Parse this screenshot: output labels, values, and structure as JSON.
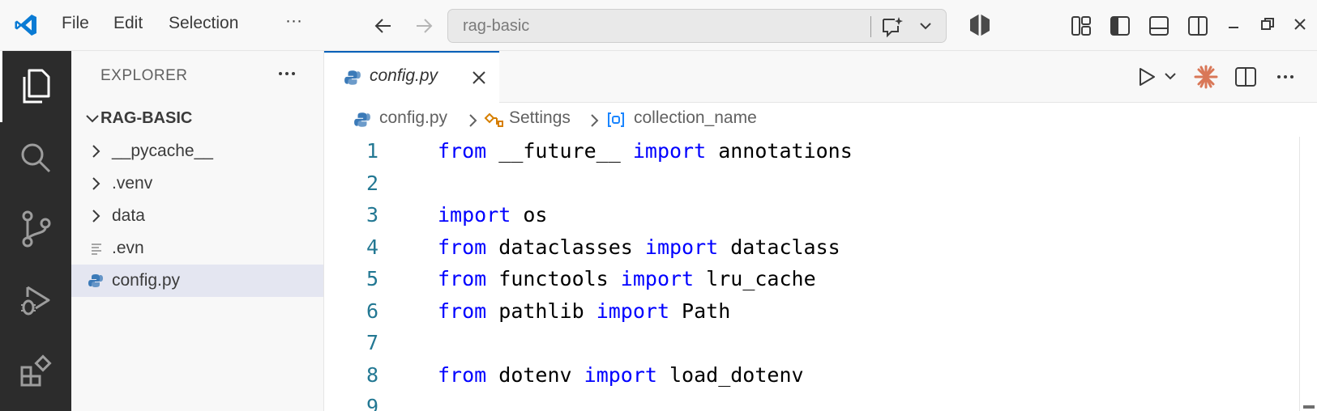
{
  "titlebar": {
    "menu": [
      "File",
      "Edit",
      "Selection"
    ],
    "more_label": "···",
    "search_text": "rag-basic"
  },
  "explorer": {
    "title": "EXPLORER",
    "project": "RAG-BASIC",
    "items": [
      {
        "label": "__pycache__",
        "type": "folder"
      },
      {
        "label": ".venv",
        "type": "folder"
      },
      {
        "label": "data",
        "type": "folder"
      },
      {
        "label": ".evn",
        "type": "file"
      },
      {
        "label": "config.py",
        "type": "python",
        "selected": true
      }
    ]
  },
  "tab": {
    "label": "config.py"
  },
  "breadcrumb": {
    "file": "config.py",
    "class": "Settings",
    "field": "collection_name"
  },
  "editor": {
    "lines": [
      {
        "n": "1",
        "tokens": [
          [
            "kw",
            "from"
          ],
          [
            "t",
            " __future__ "
          ],
          [
            "kw",
            "import"
          ],
          [
            "t",
            " annotations"
          ]
        ]
      },
      {
        "n": "2",
        "tokens": []
      },
      {
        "n": "3",
        "tokens": [
          [
            "kw",
            "import"
          ],
          [
            "t",
            " os"
          ]
        ]
      },
      {
        "n": "4",
        "tokens": [
          [
            "kw",
            "from"
          ],
          [
            "t",
            " dataclasses "
          ],
          [
            "kw",
            "import"
          ],
          [
            "t",
            " dataclass"
          ]
        ]
      },
      {
        "n": "5",
        "tokens": [
          [
            "kw",
            "from"
          ],
          [
            "t",
            " functools "
          ],
          [
            "kw",
            "import"
          ],
          [
            "t",
            " lru_cache"
          ]
        ]
      },
      {
        "n": "6",
        "tokens": [
          [
            "kw",
            "from"
          ],
          [
            "t",
            " pathlib "
          ],
          [
            "kw",
            "import"
          ],
          [
            "t",
            " Path"
          ]
        ]
      },
      {
        "n": "7",
        "tokens": []
      },
      {
        "n": "8",
        "tokens": [
          [
            "kw",
            "from"
          ],
          [
            "t",
            " dotenv "
          ],
          [
            "kw",
            "import"
          ],
          [
            "t",
            " load_dotenv"
          ]
        ]
      },
      {
        "n": "9",
        "tokens": []
      }
    ]
  },
  "colors": {
    "accent": "#005fb8",
    "keyword": "#0000ff",
    "line_number": "#237893",
    "activity_bar": "#2c2c2c"
  },
  "icons": {
    "app": "vscode-logo-icon",
    "back": "arrow-left-icon",
    "forward": "arrow-right-icon",
    "chat": "chat-sparkle-icon",
    "layout": [
      "customize-layout-icon",
      "toggle-primary-sidebar-icon",
      "toggle-panel-icon",
      "toggle-secondary-sidebar-icon"
    ],
    "window": [
      "minimize-icon",
      "restore-icon",
      "close-icon"
    ],
    "activity": [
      "explorer-icon",
      "search-icon",
      "source-control-icon",
      "run-debug-icon",
      "extensions-icon"
    ],
    "editor_actions": [
      "run-icon",
      "claude-icon",
      "split-editor-icon",
      "more-actions-icon"
    ]
  }
}
